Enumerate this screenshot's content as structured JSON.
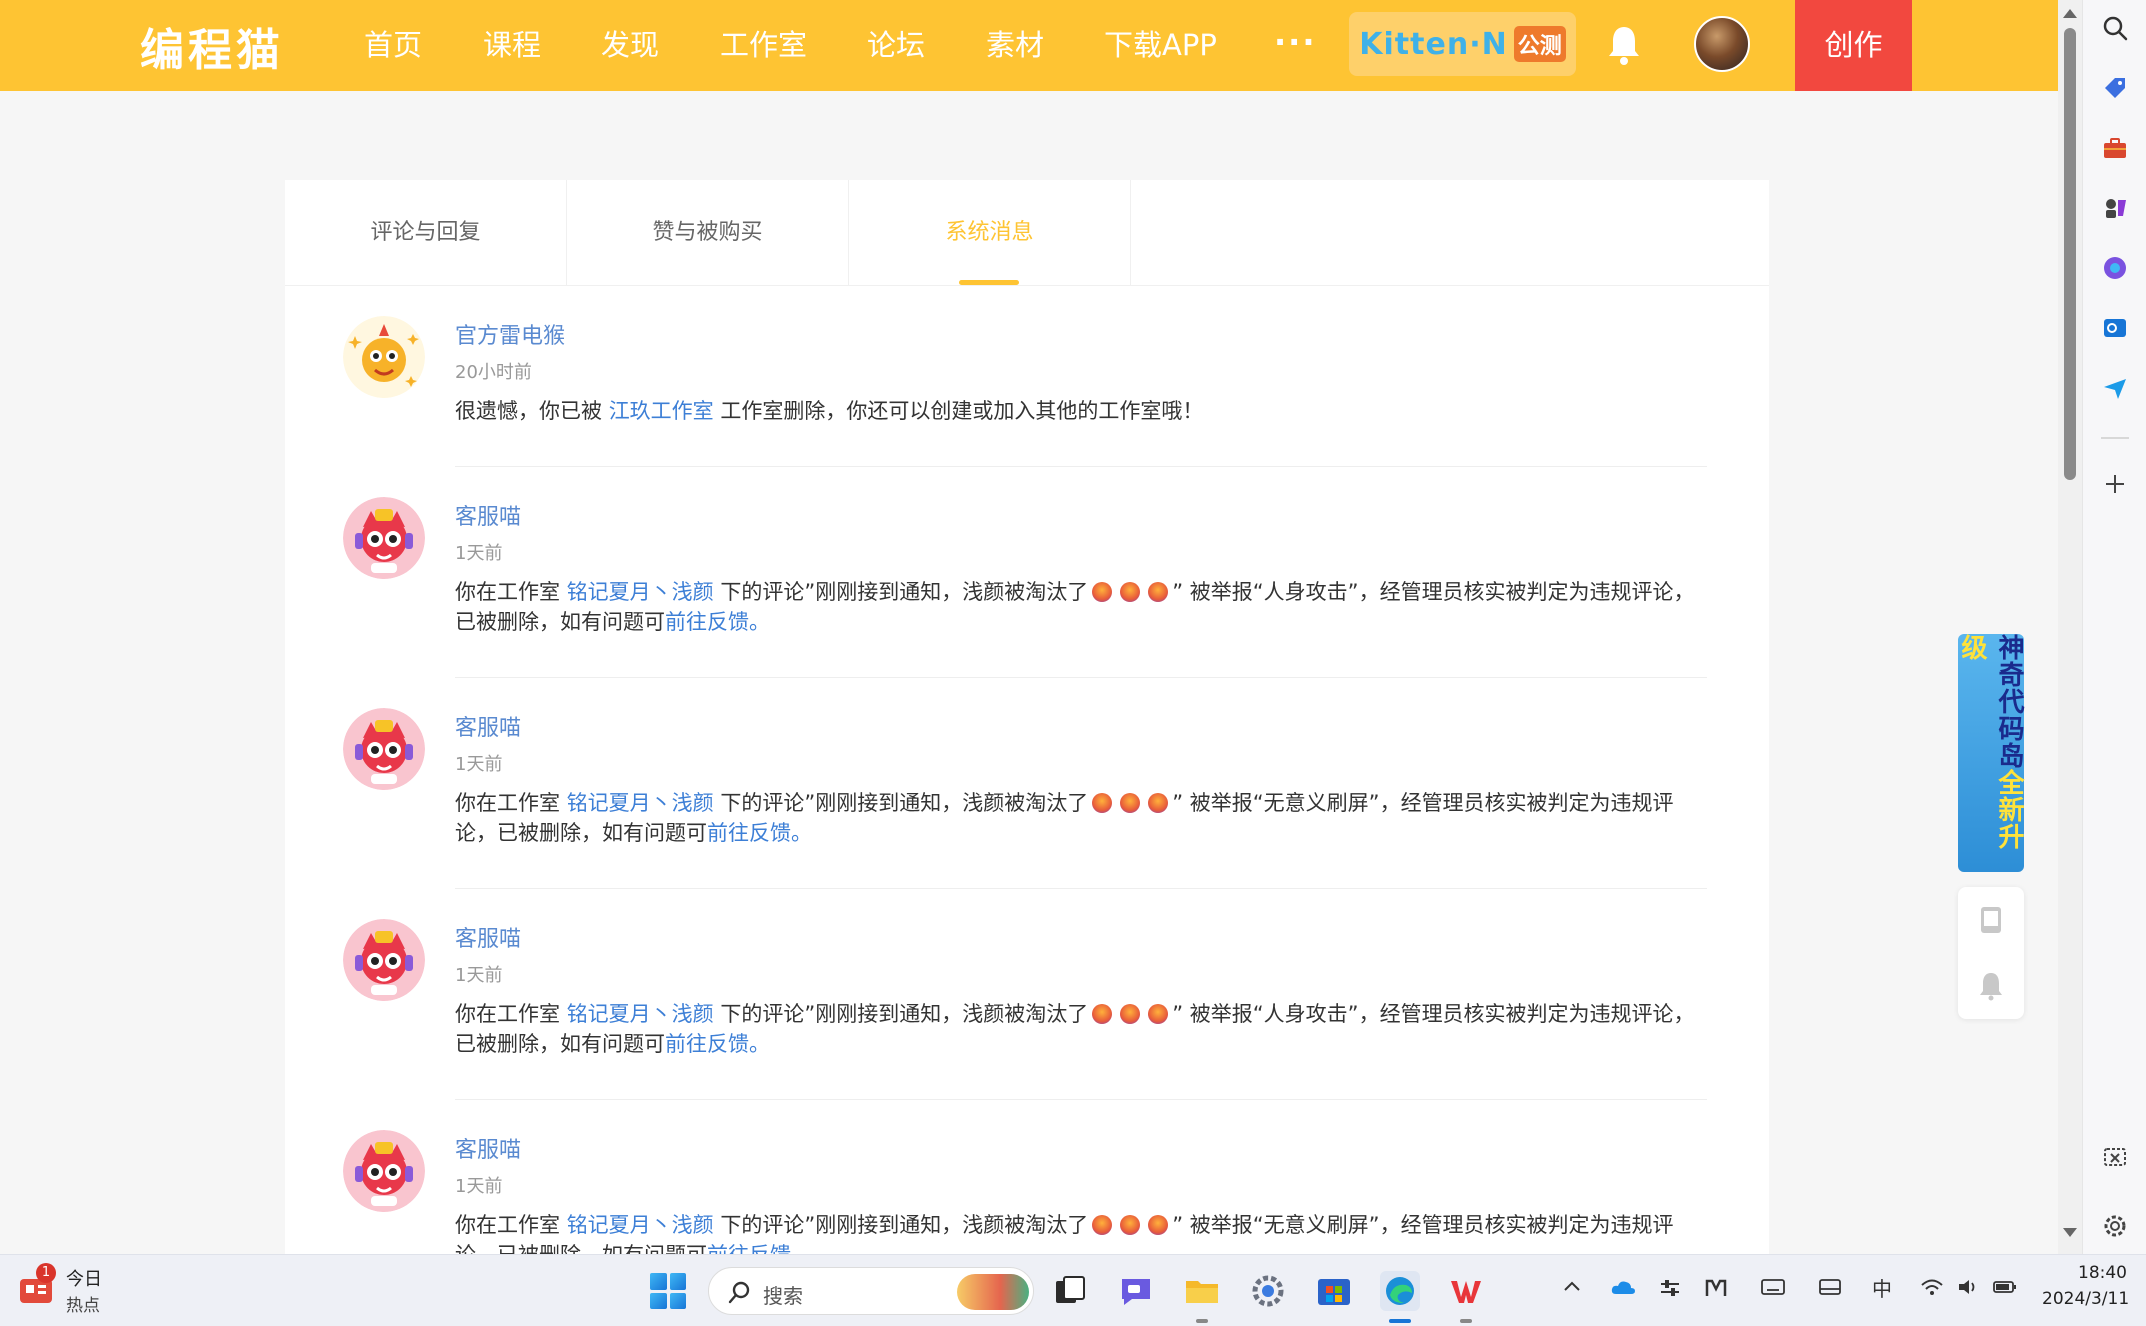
{
  "nav": {
    "logo": "编程猫",
    "items": [
      "首页",
      "课程",
      "发现",
      "工作室",
      "论坛",
      "素材",
      "下载APP"
    ],
    "more": "···",
    "kitten": {
      "name": "Kitten·N",
      "tag": "公测"
    },
    "create": "创作"
  },
  "tabs": [
    "评论与回复",
    "赞与被购买",
    "系统消息"
  ],
  "active_tab": "系统消息",
  "messages": [
    {
      "name": "官方雷电猴",
      "time": "20小时前",
      "text_before": "很遗憾，你已被 ",
      "link1": "江玖工作室",
      "text_after": " 工作室删除，你还可以创建或加入其他的工作室哦！"
    },
    {
      "name": "客服喵",
      "time": "1天前",
      "text_before": "你在工作室 ",
      "link1": "铭记夏月丶浅颜",
      "text_mid": " 下的评论”刚刚接到通知，浅颜被淘汰了",
      "text_report": "” 被举报“人身攻击”，经管理员核实被判定为违规评论，已被删除，如有问题可",
      "link2": "前往反馈",
      "text_end": "。"
    },
    {
      "name": "客服喵",
      "time": "1天前",
      "text_before": "你在工作室 ",
      "link1": "铭记夏月丶浅颜",
      "text_mid": " 下的评论”刚刚接到通知，浅颜被淘汰了",
      "text_report": "” 被举报“无意义刷屏”，经管理员核实被判定为违规评论，已被删除，如有问题可",
      "link2": "前往反馈",
      "text_end": "。"
    },
    {
      "name": "客服喵",
      "time": "1天前",
      "text_before": "你在工作室 ",
      "link1": "铭记夏月丶浅颜",
      "text_mid": " 下的评论”刚刚接到通知，浅颜被淘汰了",
      "text_report": "” 被举报“人身攻击”，经管理员核实被判定为违规评论，已被删除，如有问题可",
      "link2": "前往反馈",
      "text_end": "。"
    },
    {
      "name": "客服喵",
      "time": "1天前",
      "text_before": "你在工作室 ",
      "link1": "铭记夏月丶浅颜",
      "text_mid": " 下的评论”刚刚接到通知，浅颜被淘汰了",
      "text_report": "” 被举报“无意义刷屏”，经管理员核实被判定为违规评论，已被删除，如有问题可",
      "link2": "前往反馈",
      "text_end": "。"
    }
  ],
  "banner": {
    "part1": "神奇代码岛",
    "part2": "全新升级"
  },
  "taskbar": {
    "badge": "1",
    "today": "今日",
    "hot": "热点",
    "search_placeholder": "搜索",
    "ime": "中",
    "time": "18:40",
    "date": "2024/3/11"
  },
  "colors": {
    "brand": "#fec433",
    "create": "#f2483f",
    "link": "#3d7fd6",
    "name": "#5a8ad0"
  }
}
